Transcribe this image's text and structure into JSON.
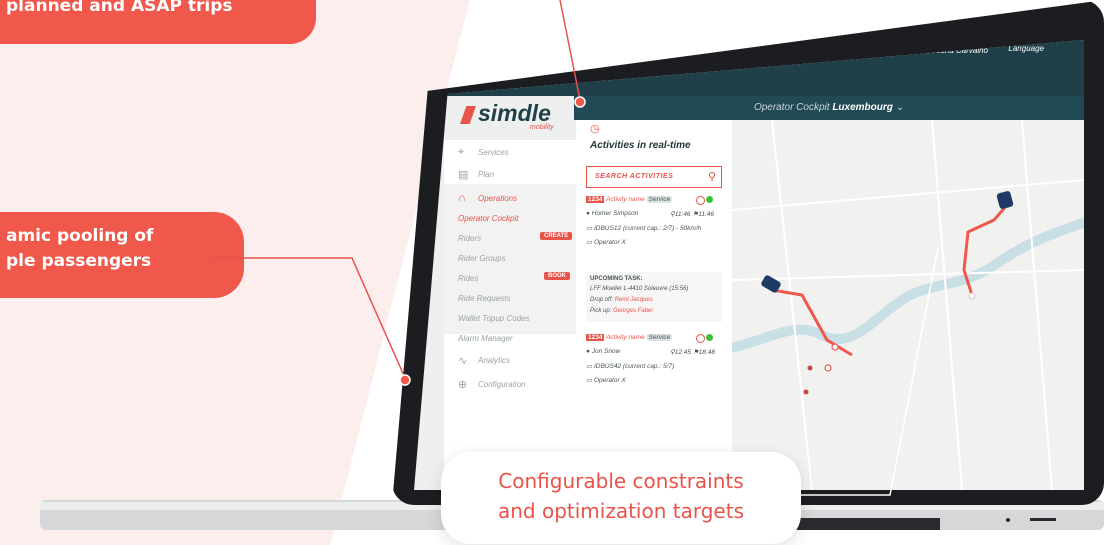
{
  "callouts": {
    "top": "planned and ASAP trips",
    "middle_line1": "amic pooling of",
    "middle_line2": "ple passengers",
    "bottom_line1": "Configurable constraints",
    "bottom_line2": "and optimization targets"
  },
  "app": {
    "logo_text": "simdle",
    "logo_sub": "mobility",
    "greeting": "Hello, Joana Carvalho",
    "language": "Language",
    "cockpit_prefix": "Operator Cockpit",
    "cockpit_city": "Luxembourg"
  },
  "sidebar": {
    "items": [
      {
        "label": "Services",
        "icon": "location-pin-icon"
      },
      {
        "label": "Plan",
        "icon": "calendar-icon"
      },
      {
        "label": "Operations",
        "icon": "headset-icon"
      },
      {
        "label": "Operator Cockpit"
      },
      {
        "label": "Riders",
        "badge": "CREATE"
      },
      {
        "label": "Rider Groups"
      },
      {
        "label": "Rides",
        "badge": "BOOK"
      },
      {
        "label": "Ride Requests"
      },
      {
        "label": "Wallet Topup Codes"
      },
      {
        "label": "Alarm Manager"
      },
      {
        "label": "Analytics",
        "icon": "chart-icon"
      },
      {
        "label": "Configuration",
        "icon": "gear-icon"
      }
    ]
  },
  "panel": {
    "title": "Activities in real-time",
    "search_placeholder": "SEARCH ACTIVITIES",
    "card1": {
      "tag": "1234",
      "name": "Activity name",
      "service": "Service",
      "driver": "Homer Simpson",
      "t1": "11:46",
      "t2": "11:46",
      "bus": "IDBUS12 (current cap.: 2/7) - 50km/h",
      "operator": "Operator X"
    },
    "upcoming": {
      "heading": "UPCOMING TASK:",
      "address": "LFF Moeller L-4410 Soleuvre (15:56)",
      "dropoff_label": "Drop off:",
      "dropoff_name": "Remi Jacques",
      "pickup_label": "Pick up:",
      "pickup_name": "Georges Faber"
    },
    "card2": {
      "tag": "1234",
      "name": "Activity name",
      "service": "Service",
      "driver": "Jon Snow",
      "t1": "12:45",
      "t2": "18:48",
      "bus": "IDBUS42 (current cap.: 5/7)",
      "operator": "Operator X"
    }
  },
  "colors": {
    "accent": "#e8534a",
    "navy": "#1f3f49",
    "route": "#f0584b",
    "bus": "#1d3b66",
    "online": "#3bbf3b"
  }
}
